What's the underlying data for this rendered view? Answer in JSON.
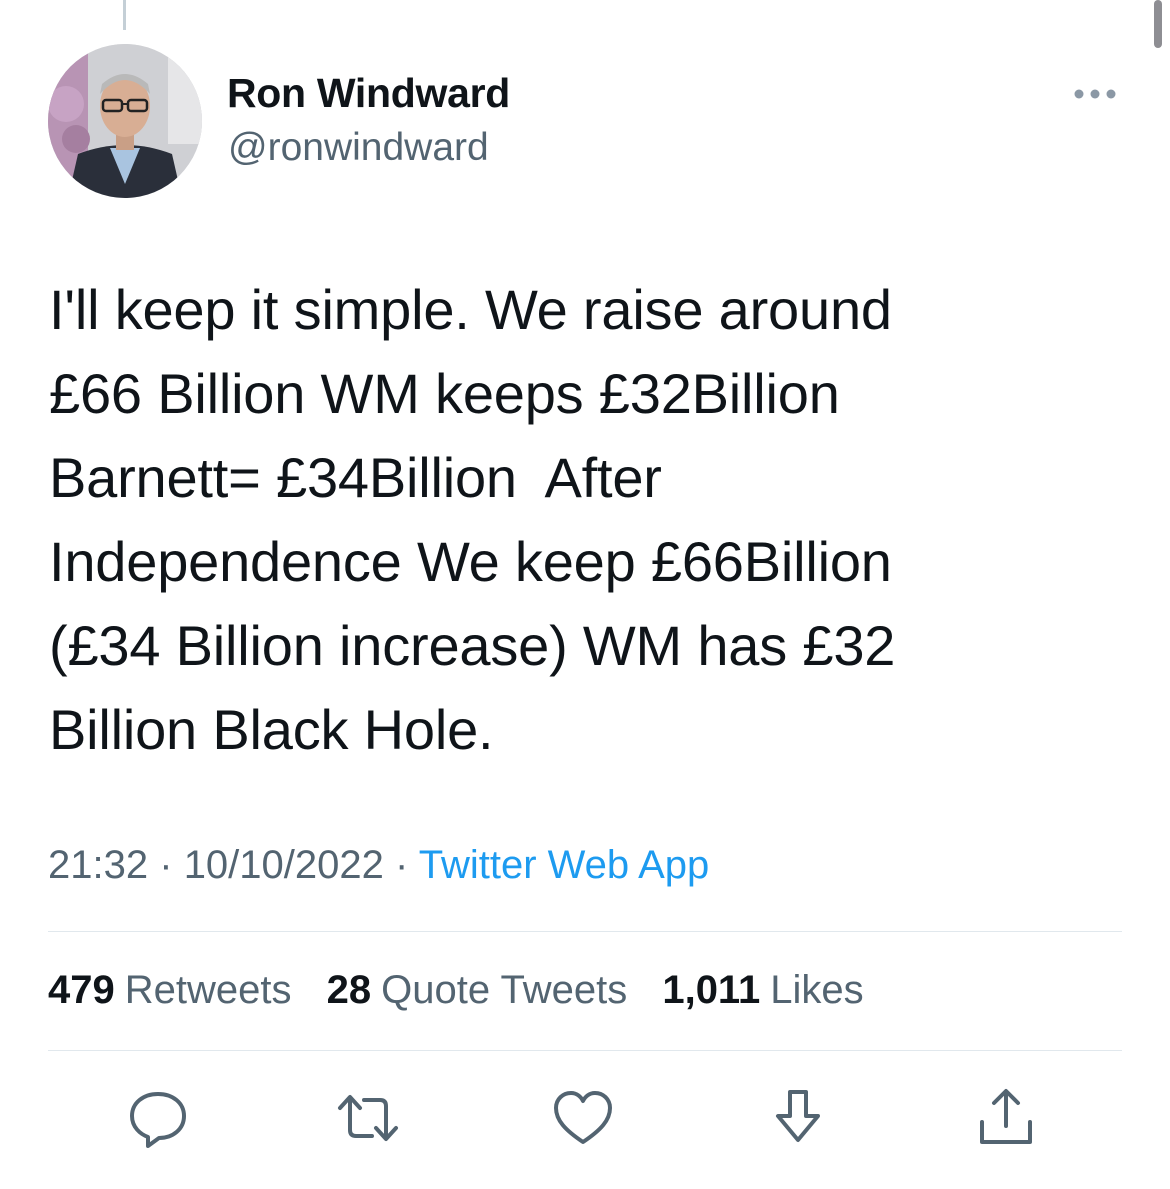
{
  "author": {
    "display_name": "Ron Windward",
    "handle": "@ronwindward"
  },
  "tweet": {
    "text_lines": [
      "I'll keep it simple. We raise around",
      "£66 Billion WM keeps £32Billion",
      "Barnett= £34Billion  After",
      "Independence We keep £66Billion",
      "(£34 Billion increase) WM has £32",
      "Billion Black Hole."
    ],
    "time": "21:32",
    "date": "10/10/2022",
    "separator": "·",
    "source": "Twitter Web App"
  },
  "stats": {
    "retweets": {
      "count": "479",
      "label": "Retweets"
    },
    "quote_tweets": {
      "count": "28",
      "label": "Quote Tweets"
    },
    "likes": {
      "count": "1,011",
      "label": "Likes"
    }
  },
  "icons": {
    "more": "more-horizontal-icon",
    "reply": "reply-icon",
    "retweet": "retweet-icon",
    "like": "heart-icon",
    "bookmark": "bookmark-download-icon",
    "share": "share-icon"
  },
  "colors": {
    "text": "#0f1419",
    "secondary": "#536471",
    "link": "#1d9bf0",
    "divider": "#e1e8ed"
  }
}
